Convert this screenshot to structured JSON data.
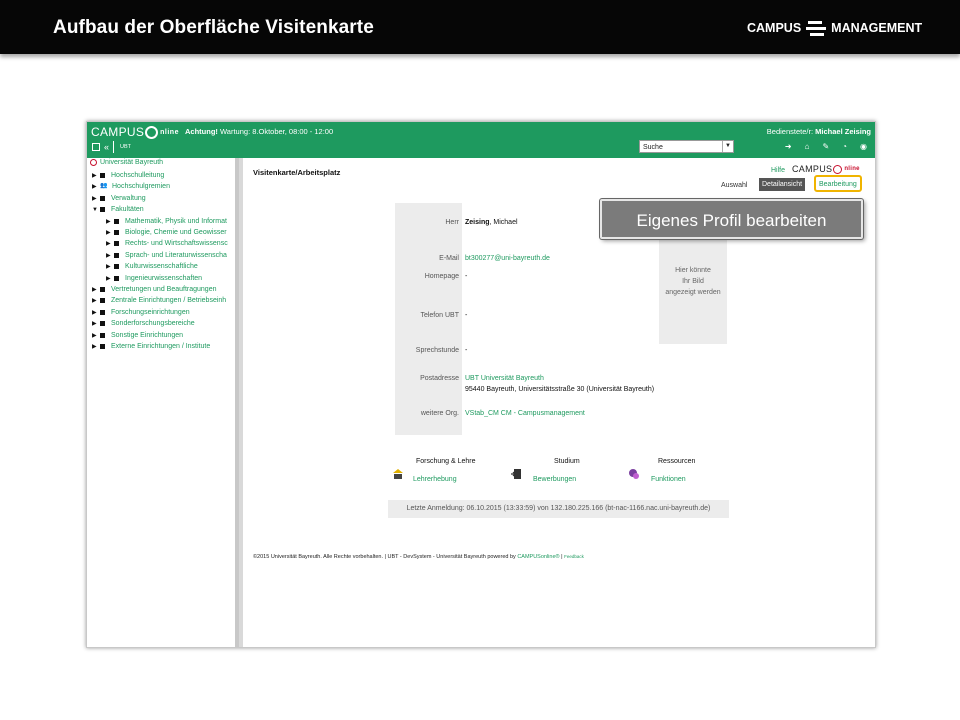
{
  "slide": {
    "title": "Aufbau der Oberfläche  Visitenkarte",
    "logo_left": "CAMPUS",
    "logo_right": "MANAGEMENT"
  },
  "header": {
    "logo_campus": "CAMPUS",
    "logo_online": "nline",
    "warning_bold": "Achtung!",
    "warning_text": " Wartung: 8.Oktober, 08:00 - 12:00",
    "ubt": "UBT",
    "user_label": "Bedienstete/r: ",
    "user_name": "Michael Zeising",
    "search_value": "Suche",
    "toolbar_icons": [
      "logout-icon",
      "home-icon",
      "edit-icon",
      "dashboard-icon",
      "palette-icon"
    ]
  },
  "tree": {
    "root": "Universität Bayreuth",
    "items": [
      {
        "label": "Hochschulleitung",
        "icon": "box",
        "level": 0
      },
      {
        "label": "Hochschulgremien",
        "icon": "people",
        "level": 0
      },
      {
        "label": "Verwaltung",
        "icon": "box",
        "level": 0
      },
      {
        "label": "Fakultäten",
        "icon": "box",
        "level": 0,
        "expanded": true
      },
      {
        "label": "Mathematik, Physik und Informat",
        "icon": "box",
        "level": 1
      },
      {
        "label": "Biologie, Chemie und Geowisser",
        "icon": "box",
        "level": 1
      },
      {
        "label": "Rechts- und Wirtschaftswissensc",
        "icon": "box",
        "level": 1
      },
      {
        "label": "Sprach- und Literaturwissenscha",
        "icon": "box",
        "level": 1
      },
      {
        "label": "Kulturwissenschaftliche",
        "icon": "box",
        "level": 1
      },
      {
        "label": "Ingenieurwissenschaften",
        "icon": "box",
        "level": 1
      },
      {
        "label": "Vertretungen und Beauftragungen",
        "icon": "box",
        "level": 0
      },
      {
        "label": "Zentrale Einrichtungen / Betriebseinh",
        "icon": "box",
        "level": 0
      },
      {
        "label": "Forschungseinrichtungen",
        "icon": "box",
        "level": 0
      },
      {
        "label": "Sonderforschungsbereiche",
        "icon": "box",
        "level": 0
      },
      {
        "label": "Sonstige Einrichtungen",
        "icon": "box",
        "level": 0
      },
      {
        "label": "Externe Einrichtungen / Institute",
        "icon": "box",
        "level": 0
      }
    ]
  },
  "content": {
    "title": "Visitenkarte/Arbeitsplatz",
    "hilfe": "Hilfe",
    "auswahl": "Auswahl",
    "detailansicht": "Detailansicht",
    "bearbeitung": "Bearbeitung",
    "callout": "Eigenes Profil bearbeiten",
    "card": {
      "salutation": "Herr",
      "name_bold": "Zeising",
      "name_rest": ", Michael",
      "email_label": "E-Mail",
      "email": "bt300277@uni-bayreuth.de",
      "homepage_label": "Homepage",
      "homepage": "-",
      "phone_label": "Telefon  UBT",
      "phone": "-",
      "office_hours_label": "Sprechstunde",
      "office_hours": "-",
      "address_label": "Postadresse",
      "address_line1": "UBT Universität Bayreuth",
      "address_line2": "95440 Bayreuth, Universitätsstraße 30 (Universität Bayreuth)",
      "org_label": "weitere Org.",
      "org": "VStab_CM CM - Campusmanagement",
      "photo_text": [
        "Hier könnte",
        "Ihr Bild",
        "angezeigt werden"
      ]
    },
    "sections": [
      {
        "heading": "Forschung & Lehre",
        "link": "Lehrerhebung",
        "icon": "teaching-icon"
      },
      {
        "heading": "Studium",
        "link": "Bewerbungen",
        "icon": "application-icon"
      },
      {
        "heading": "Ressourcen",
        "link": "Funktionen",
        "icon": "resources-icon"
      }
    ],
    "last_login": "Letzte Anmeldung: 06.10.2015 (13:33:59) von 132.180.225.166 (bt-nac-1166.nac.uni-bayreuth.de)",
    "footer_text": "©2015 Universität Bayreuth. Alle Rechte vorbehalten. | UBT - DevSystem - Universität Bayreuth powered by ",
    "footer_link": "CAMPUSonline®",
    "footer_sep": " | ",
    "footer_feedback": "Feedback"
  },
  "colors": {
    "green": "#1e9a5f",
    "highlight": "#f0b400",
    "red": "#c8102e"
  }
}
